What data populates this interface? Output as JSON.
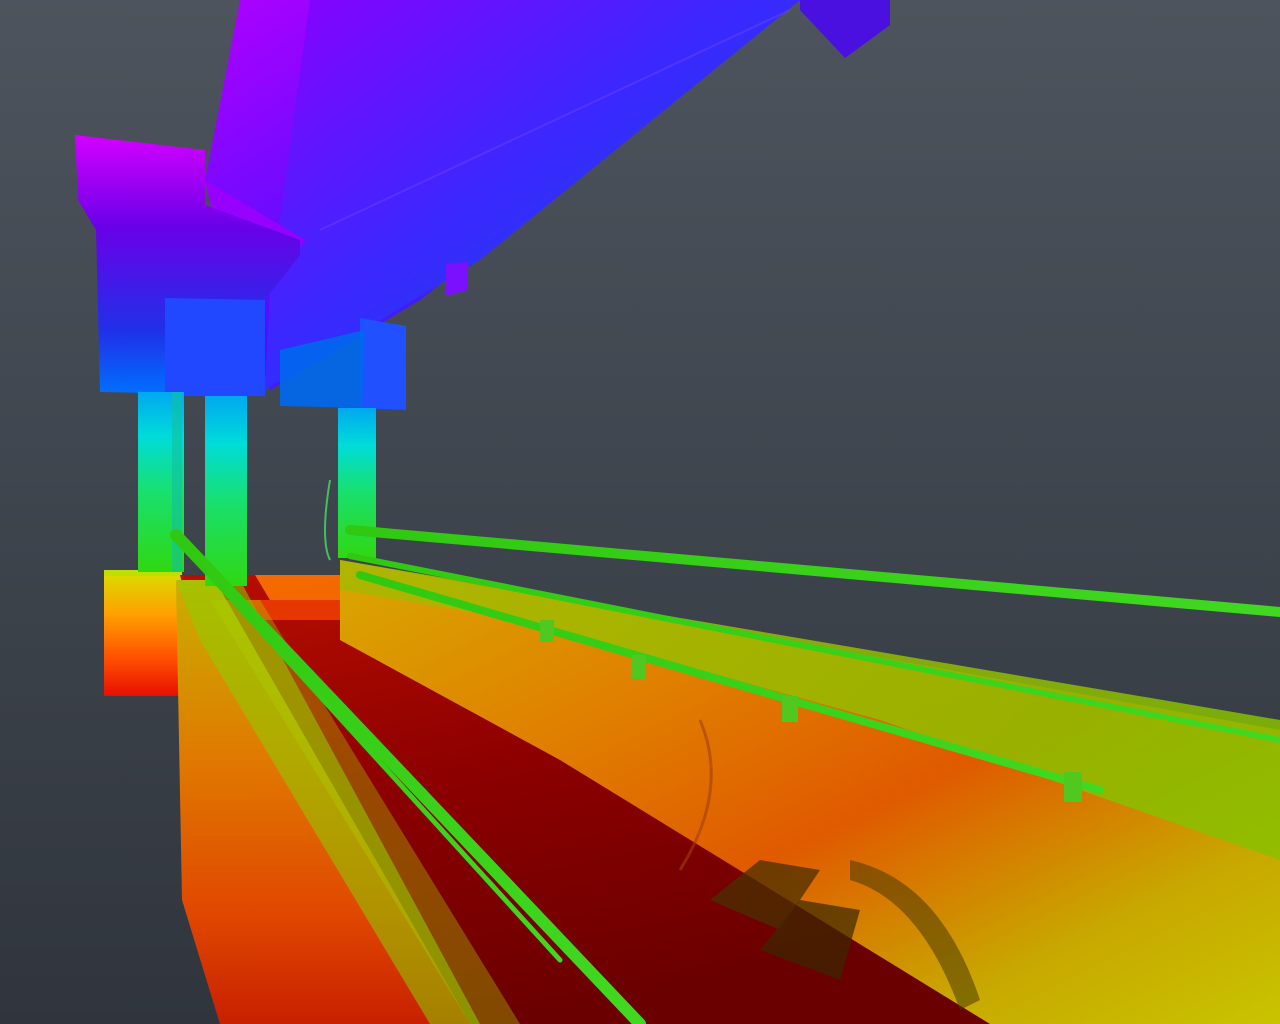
{
  "viewer": {
    "mode": "point-cloud-3d-view",
    "color_ramp": "elevation-rainbow",
    "ramp_colors": [
      "#7a0000",
      "#d81a00",
      "#ff7a00",
      "#e7e400",
      "#2fdc00",
      "#00e4d6",
      "#0068ff",
      "#4a00ff",
      "#d600ff"
    ],
    "background_top": "#4d545d",
    "background_bottom": "#2c3038"
  },
  "scene": {
    "objects": [
      "overhead-beam",
      "cross-beam",
      "support-column-left",
      "support-column-middle",
      "support-column-right",
      "walkway-handrail-left",
      "walkway-handrail-right",
      "walkway-deck",
      "large-pipe-right",
      "large-pipe-left"
    ]
  }
}
